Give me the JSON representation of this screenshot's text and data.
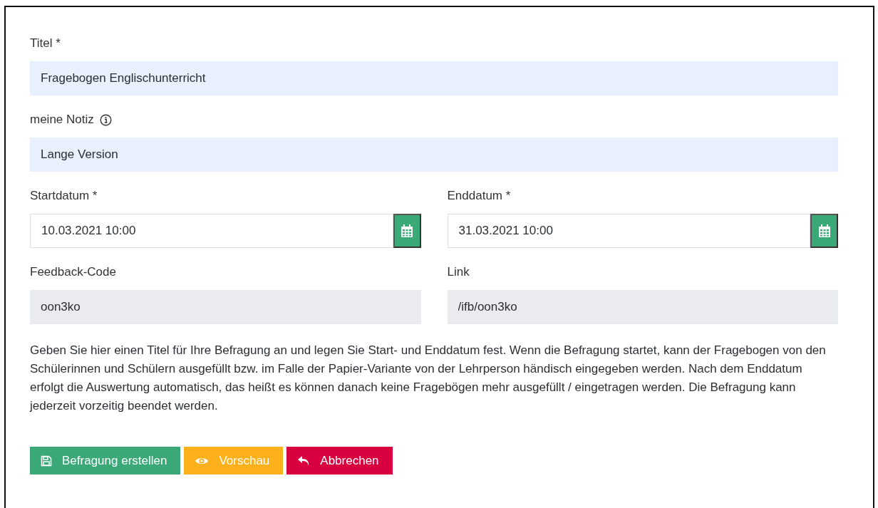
{
  "title_field": {
    "label": "Titel *",
    "value": "Fragebogen Englischunterricht",
    "kind": "text"
  },
  "note_field": {
    "label": "meine Notiz",
    "value": "Lange Version",
    "kind": "text",
    "info": true
  },
  "date_fields": [
    {
      "label": "Startdatum *",
      "value": "10.03.2021 10:00",
      "kind": "date"
    },
    {
      "label": "Enddatum *",
      "value": "31.03.2021 10:00",
      "kind": "date"
    }
  ],
  "readonly_fields": [
    {
      "label": "Feedback-Code",
      "value": "oon3ko",
      "kind": "readonly"
    },
    {
      "label": "Link",
      "value": "/ifb/oon3ko",
      "kind": "readonly"
    }
  ],
  "help_text": "Geben Sie hier einen Titel für Ihre Befragung an und legen Sie Start- und Enddatum fest. Wenn die Befragung startet, kann der Fragebogen von den Schülerinnen und Schülern ausgefüllt bzw. im Falle der Papier-Variante von der Lehrperson händisch eingegeben werden. Nach dem Enddatum erfolgt die Auswertung automatisch, das heißt es können danach keine Fragebögen mehr ausgefüllt / eingetragen werden. Die Befragung kann jederzeit vorzeitig beendet werden.",
  "buttons": [
    {
      "label": "Befragung erstellen",
      "kind": "save"
    },
    {
      "label": "Vorschau",
      "kind": "preview"
    },
    {
      "label": "Abbrechen",
      "kind": "cancel"
    }
  ]
}
